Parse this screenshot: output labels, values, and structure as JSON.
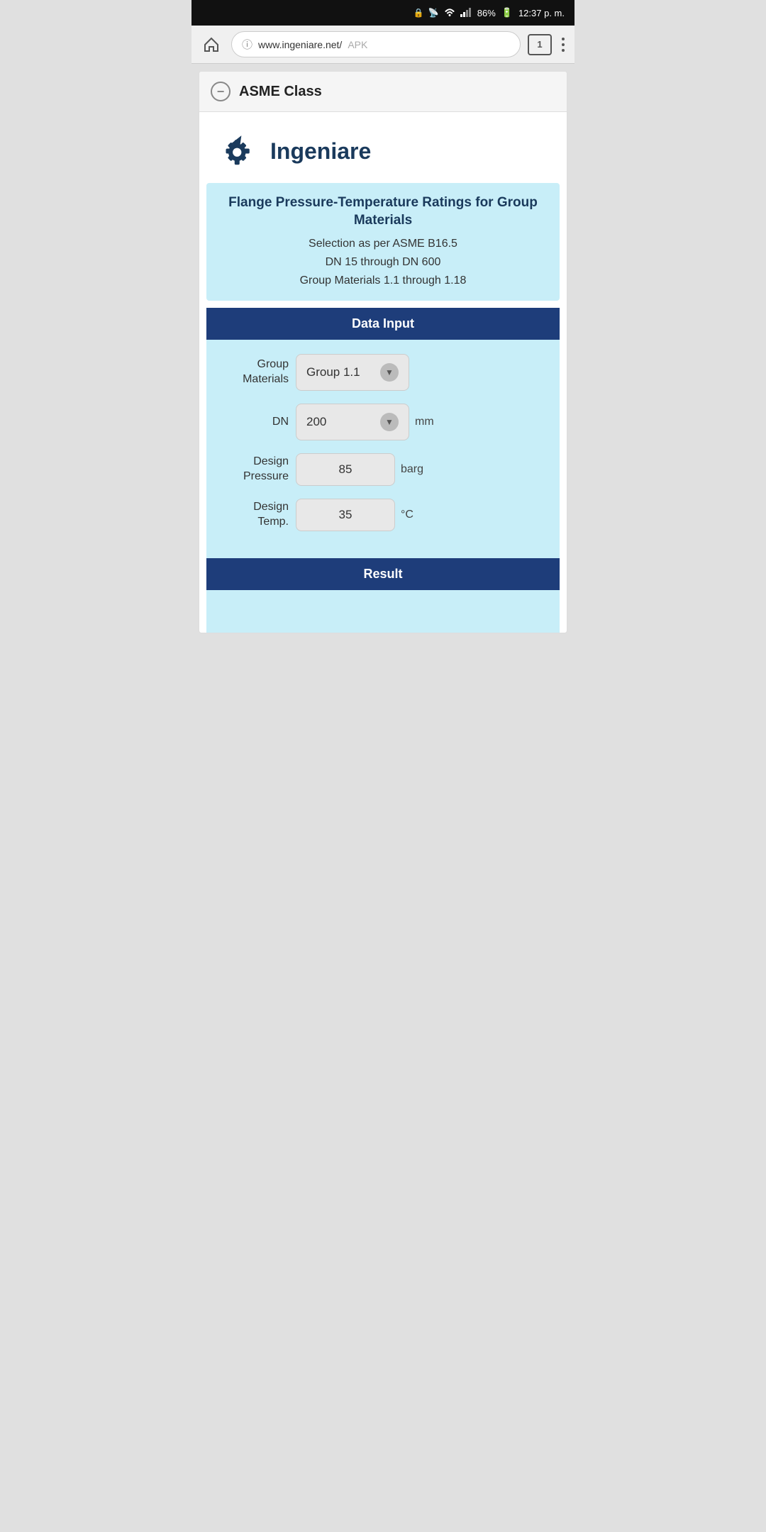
{
  "status_bar": {
    "battery": "86%",
    "time": "12:37 p. m.",
    "icons": [
      "cast-icon",
      "wifi-icon",
      "signal-icon",
      "battery-icon"
    ]
  },
  "browser": {
    "url_base": "www.ingeniare.net/",
    "url_path": "APK",
    "tab_count": "1"
  },
  "section": {
    "title": "ASME Class",
    "collapse_symbol": "−"
  },
  "logo": {
    "text": "Ingeniare"
  },
  "info_box": {
    "main_title": "Flange Pressure-Temperature Ratings for Group Materials",
    "line1": "Selection as per ASME B16.5",
    "line2": "DN 15 through DN 600",
    "line3": "Group Materials 1.1 through 1.18"
  },
  "data_input": {
    "header": "Data Input",
    "fields": [
      {
        "label": "Group\nMaterials",
        "type": "dropdown",
        "value": "Group 1.1",
        "unit": ""
      },
      {
        "label": "DN",
        "type": "dropdown",
        "value": "200",
        "unit": "mm"
      },
      {
        "label": "Design\nPressure",
        "type": "number",
        "value": "85",
        "unit": "barg"
      },
      {
        "label": "Design\nTemp.",
        "type": "number",
        "value": "35",
        "unit": "°C"
      }
    ]
  },
  "result": {
    "header": "Result"
  }
}
